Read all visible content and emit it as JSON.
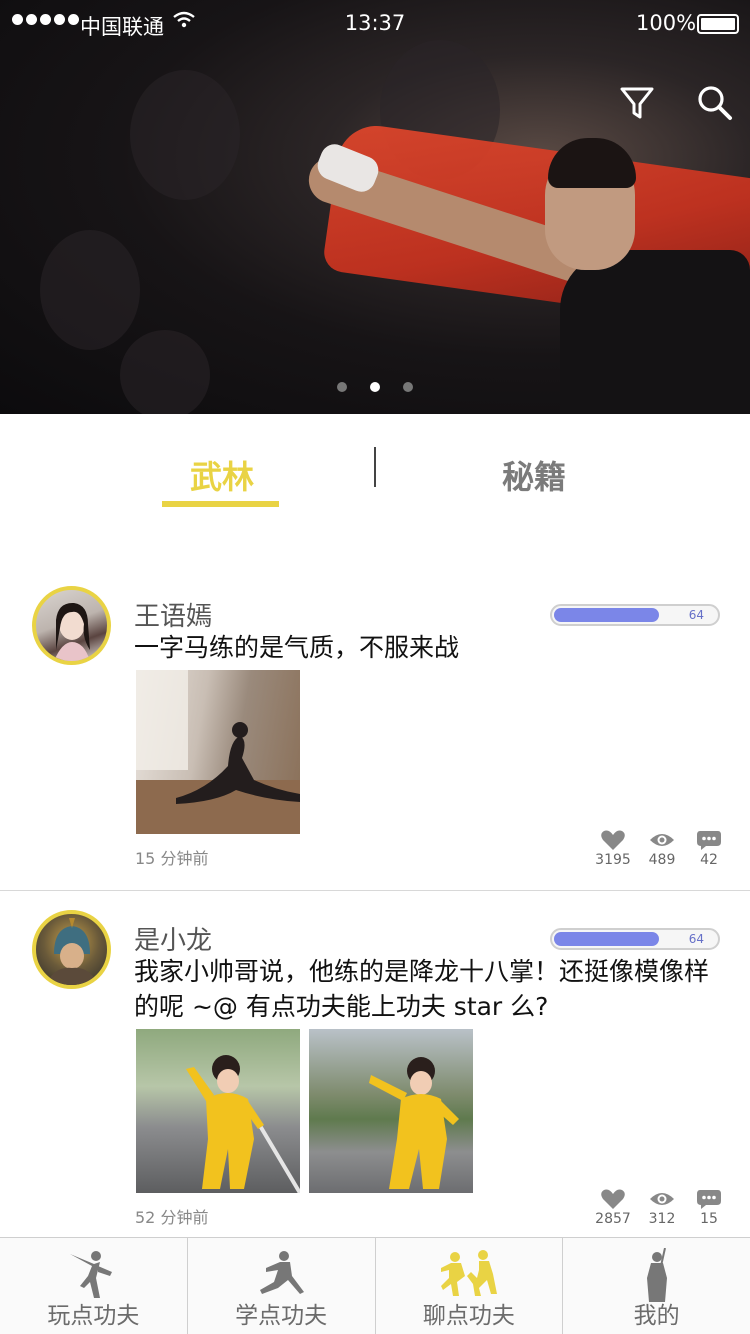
{
  "status_bar": {
    "carrier": "中国联通",
    "wifi_icon": "wifi-icon",
    "time": "13:37",
    "battery": "100%"
  },
  "banner": {
    "filter_icon": "filter-icon",
    "search_icon": "search-icon",
    "carousel_page_count": 3,
    "carousel_active_index": 1
  },
  "tabs": [
    {
      "label": "武林",
      "active": true
    },
    {
      "label": "秘籍",
      "active": false
    }
  ],
  "colors": {
    "accent": "#e9d344",
    "level_bar": "#7b86e8",
    "inactive_text": "#7b7b7b"
  },
  "posts": [
    {
      "username": "王语嫣",
      "content": "一字马练的是气质，不服来战",
      "level": 64,
      "level_fraction": 0.65,
      "time": "15 分钟前",
      "likes": "3195",
      "views": "489",
      "comments": "42"
    },
    {
      "username": "是小龙",
      "content": "我家小帅哥说，他练的是降龙十八掌！还挺像模像样的呢 ~@ 有点功夫能上功夫 star 么?",
      "level": 64,
      "level_fraction": 0.65,
      "time": "52 分钟前",
      "likes": "2857",
      "views": "312",
      "comments": "15"
    }
  ],
  "bottom_nav": [
    {
      "label": "玩点功夫",
      "active": false
    },
    {
      "label": "学点功夫",
      "active": false
    },
    {
      "label": "聊点功夫",
      "active": true
    },
    {
      "label": "我的",
      "active": false
    }
  ]
}
